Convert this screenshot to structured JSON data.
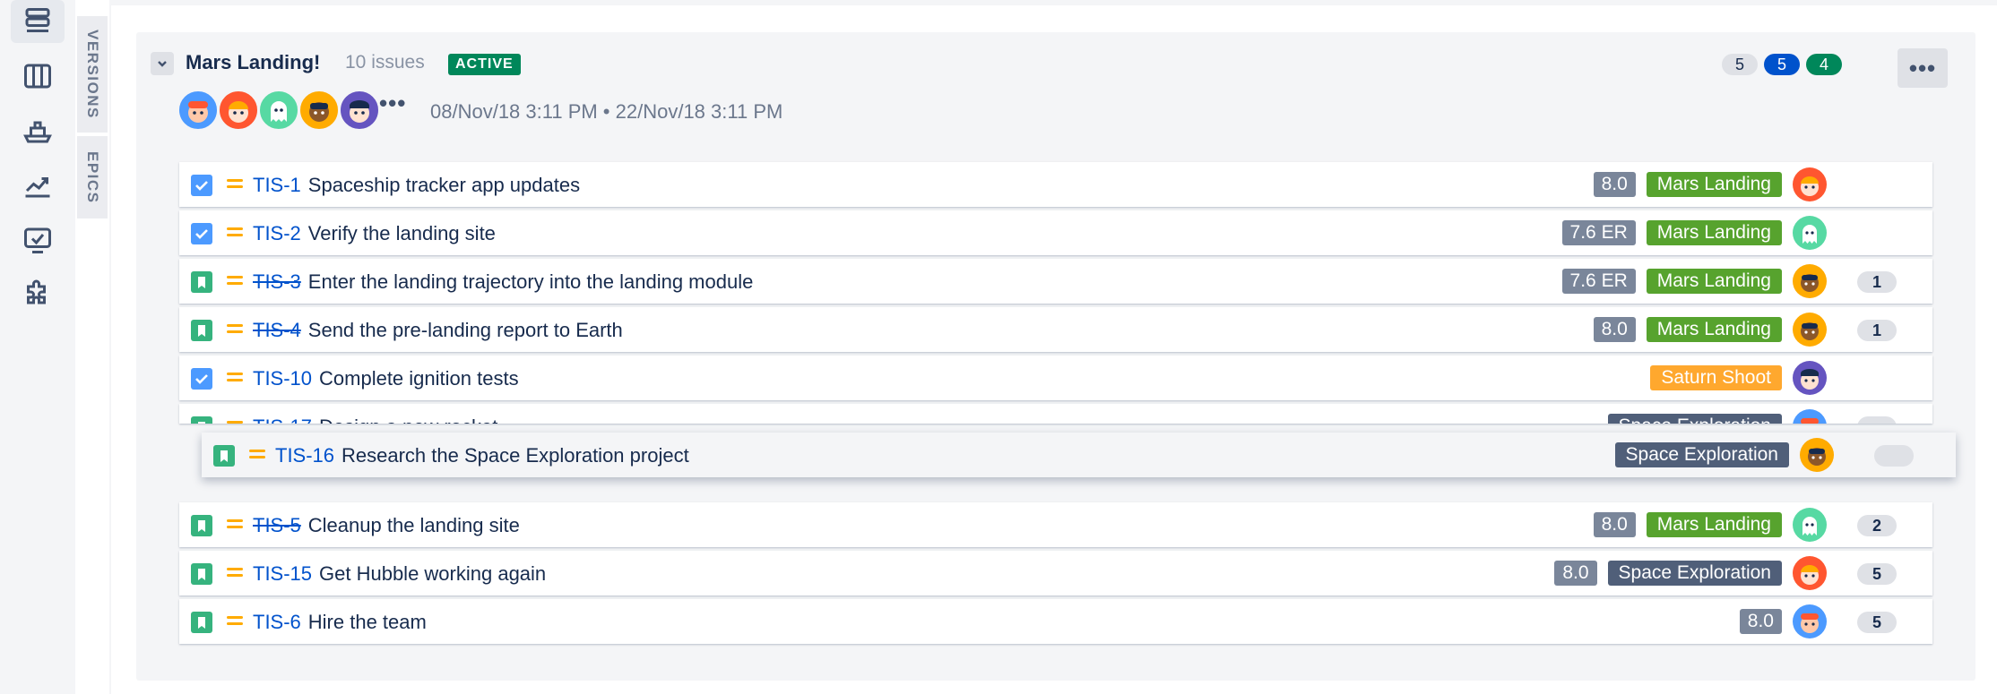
{
  "nav": {
    "icons": [
      "backlog-icon",
      "board-icon",
      "releases-icon",
      "reports-icon",
      "issues-icon",
      "addon-icon"
    ],
    "tabs": [
      "VERSIONS",
      "EPICS"
    ]
  },
  "sprint": {
    "name": "Mars Landing!",
    "issue_count": "10 issues",
    "status": "ACTIVE",
    "counts": {
      "todo": "5",
      "in_progress": "5",
      "done": "4"
    },
    "more": "•••",
    "team_more": "•••",
    "date_range": "08/Nov/18 3:11 PM  •  22/Nov/18 3:11 PM"
  },
  "colors": {
    "mars_landing": "#57a32e",
    "saturn_shoot": "#ffa82e",
    "space_exploration": "#505f79",
    "version": "#7a869a",
    "active": "#00875a"
  },
  "issues": [
    {
      "type": "task",
      "key": "TIS-1",
      "summary": "Spaceship tracker app updates",
      "done": false,
      "version": "8.0",
      "epic": "Mars Landing",
      "assignee": "red-hair-avatar",
      "points": ""
    },
    {
      "type": "task",
      "key": "TIS-2",
      "summary": "Verify the landing site",
      "done": false,
      "version": "7.6 ER",
      "epic": "Mars Landing",
      "assignee": "ghost-avatar",
      "points": ""
    },
    {
      "type": "story",
      "key": "TIS-3",
      "summary": "Enter the landing trajectory into the landing module",
      "done": true,
      "version": "7.6 ER",
      "epic": "Mars Landing",
      "assignee": "orange-avatar",
      "points": "1"
    },
    {
      "type": "story",
      "key": "TIS-4",
      "summary": "Send the pre-landing report to Earth",
      "done": true,
      "version": "8.0",
      "epic": "Mars Landing",
      "assignee": "orange-avatar",
      "points": "1"
    },
    {
      "type": "task",
      "key": "TIS-10",
      "summary": "Complete ignition tests",
      "done": false,
      "version": "",
      "epic": "Saturn Shoot",
      "assignee": "purple-avatar",
      "points": ""
    },
    {
      "type": "story",
      "key": "TIS-17",
      "summary": "Design a new rocket",
      "done": false,
      "version": "",
      "epic": "Space Exploration",
      "assignee": "blue-avatar",
      "points": ""
    },
    {
      "type": "story",
      "key": "TIS-5",
      "summary": "Cleanup the landing site",
      "done": true,
      "version": "8.0",
      "epic": "Mars Landing",
      "assignee": "ghost-avatar",
      "points": "2"
    },
    {
      "type": "story",
      "key": "TIS-15",
      "summary": "Get Hubble working again",
      "done": false,
      "version": "8.0",
      "epic": "Space Exploration",
      "assignee": "red-hair-avatar",
      "points": "5"
    },
    {
      "type": "story",
      "key": "TIS-6",
      "summary": "Hire the team",
      "done": false,
      "version": "8.0",
      "epic": "",
      "assignee": "blue-avatar",
      "points": "5"
    }
  ],
  "dragging": {
    "type": "story",
    "key": "TIS-16",
    "summary": "Research the Space Exploration project",
    "epic": "Space Exploration",
    "assignee": "orange-avatar",
    "points": ""
  }
}
